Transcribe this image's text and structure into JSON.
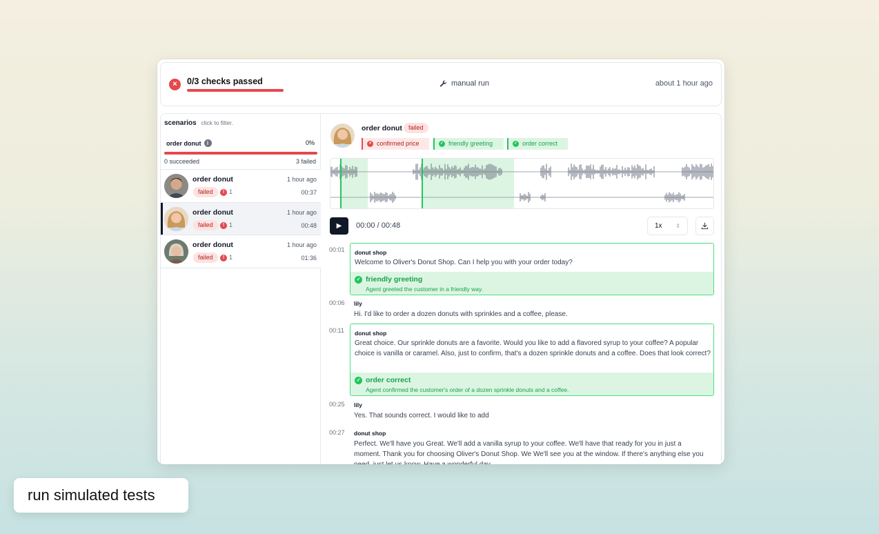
{
  "header": {
    "checks_label": "0/3 checks passed",
    "run_type": "manual run",
    "time_ago": "about 1 hour ago",
    "status_icon": "x-icon",
    "run_icon": "wrench-icon"
  },
  "sidebar": {
    "title": "scenarios",
    "hint": "click to filter.",
    "group": {
      "name": "order donut",
      "percent": "0%",
      "succeeded": "0 succeeded",
      "failed": "3 failed",
      "progress": 1.0
    },
    "runs": [
      {
        "name": "order donut",
        "time": "1 hour ago",
        "status": "failed",
        "errors": "1",
        "duration": "00:37",
        "selected": false
      },
      {
        "name": "order donut",
        "time": "1 hour ago",
        "status": "failed",
        "errors": "1",
        "duration": "00:48",
        "selected": true
      },
      {
        "name": "order donut",
        "time": "1 hour ago",
        "status": "failed",
        "errors": "1",
        "duration": "01:36",
        "selected": false
      }
    ]
  },
  "main": {
    "title": "order donut",
    "status": "failed",
    "checks": [
      {
        "label": "confirmed price",
        "result": "failed"
      },
      {
        "label": "friendly greeting",
        "result": "passed"
      },
      {
        "label": "order correct",
        "result": "passed"
      }
    ],
    "player": {
      "time": "00:00 / 00:48",
      "speed": "1x",
      "play_icon": "play-icon",
      "download_icon": "download-icon"
    },
    "transcript": [
      {
        "ts": "00:01",
        "speaker": "donut shop",
        "text": "Welcome to Oliver's Donut Shop. Can I help you with your order today?",
        "eval": {
          "title": "friendly greeting",
          "desc": "Agent greeted the customer in a friendly way."
        }
      },
      {
        "ts": "00:06",
        "speaker": "lily",
        "text": "Hi. I'd like to order a dozen donuts with sprinkles and a coffee, please."
      },
      {
        "ts": "00:11",
        "speaker": "donut shop",
        "text": "Great choice. Our sprinkle donuts are a favorite. Would you like to add a flavored syrup to your coffee? A popular choice is vanilla or caramel. Also, just to confirm, that's a dozen sprinkle donuts and a coffee. Does that look correct?",
        "eval": {
          "title": "order correct",
          "desc": "Agent confirmed the customer's order of a dozen sprinkle donuts and a coffee."
        }
      },
      {
        "ts": "00:25",
        "speaker": "lily",
        "text": "Yes. That sounds correct. I would like to add"
      },
      {
        "ts": "00:27",
        "speaker": "donut shop",
        "text": "Perfect. We'll have you Great. We'll add a vanilla syrup to your coffee. We'll have that ready for you in just a moment. Thank you for choosing Oliver's Donut Shop. We We'll see you at the window. If there's anything else you need, just let us know. Have a wonderful day."
      }
    ]
  },
  "caption": "run simulated tests",
  "colors": {
    "fail": "#e5484d",
    "pass": "#22c55e",
    "pass_bg": "#dcf5e2",
    "fail_bg": "#fde2e2",
    "dark": "#111827"
  }
}
